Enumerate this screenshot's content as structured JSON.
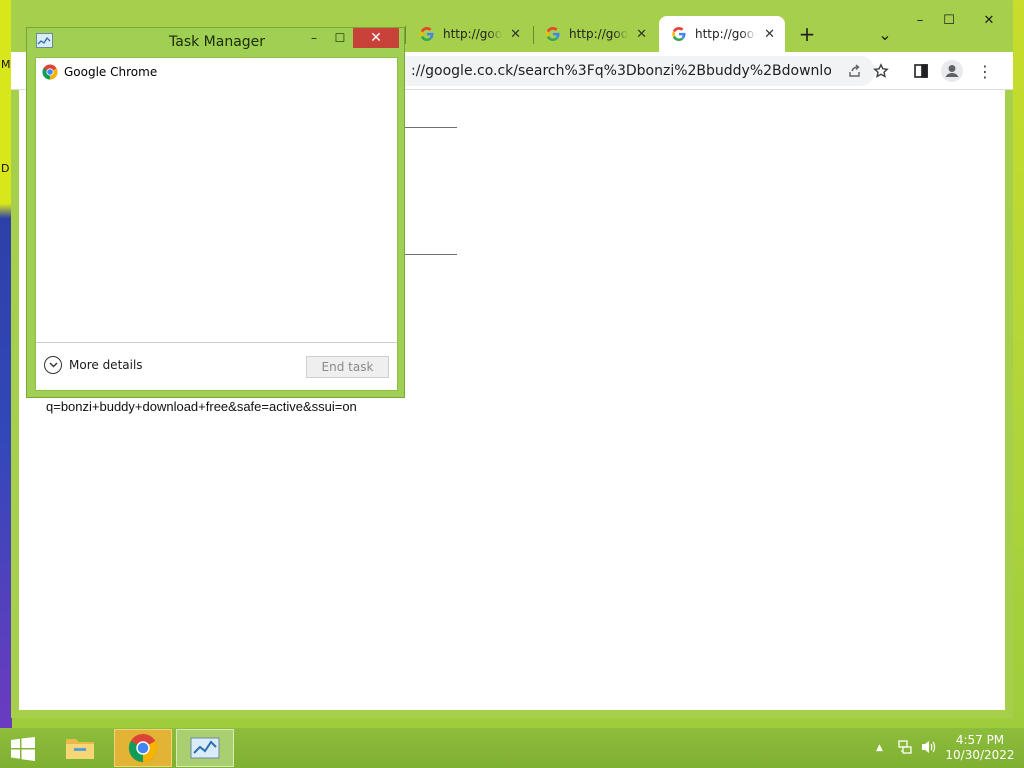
{
  "colors": {
    "desktop_accent": "#b2d63a",
    "window_frame": "#a6cf4c",
    "close_red": "#c9423a",
    "chrome_taskbar_highlight": "#e2b335"
  },
  "desktop": {
    "left_fragments": [
      "M",
      "D"
    ]
  },
  "chrome": {
    "tabs": [
      {
        "title": "http://goog",
        "icon": "google-g-icon",
        "active": false
      },
      {
        "title": "http://goog",
        "icon": "google-g-icon",
        "active": false
      },
      {
        "title": "http://goog",
        "icon": "google-g-icon",
        "active": true
      }
    ],
    "new_tab_symbol": "+",
    "tab_search_symbol": "⌄",
    "window_controls": {
      "minimize": "–",
      "maximize": "☐",
      "close": "✕"
    },
    "address_text": "://google.co.ck/search%3Fq%3Dbonzi%2Bbuddy%2Bdownload%2...",
    "page": {
      "query_text": "q=bonzi+buddy+download+free&safe=active&ssui=on"
    }
  },
  "task_manager": {
    "title": "Task Manager",
    "controls": {
      "minimize": "–",
      "maximize": "☐",
      "close": "✕"
    },
    "processes": [
      {
        "name": "Google Chrome",
        "icon": "chrome-icon"
      }
    ],
    "more_details_label": "More details",
    "end_task_label": "End task"
  },
  "taskbar": {
    "apps": [
      {
        "name": "file-explorer",
        "icon": "folder-icon"
      },
      {
        "name": "google-chrome",
        "icon": "chrome-icon"
      },
      {
        "name": "task-manager",
        "icon": "task-manager-icon"
      }
    ],
    "clock": {
      "time": "4:57 PM",
      "date": "10/30/2022"
    }
  }
}
